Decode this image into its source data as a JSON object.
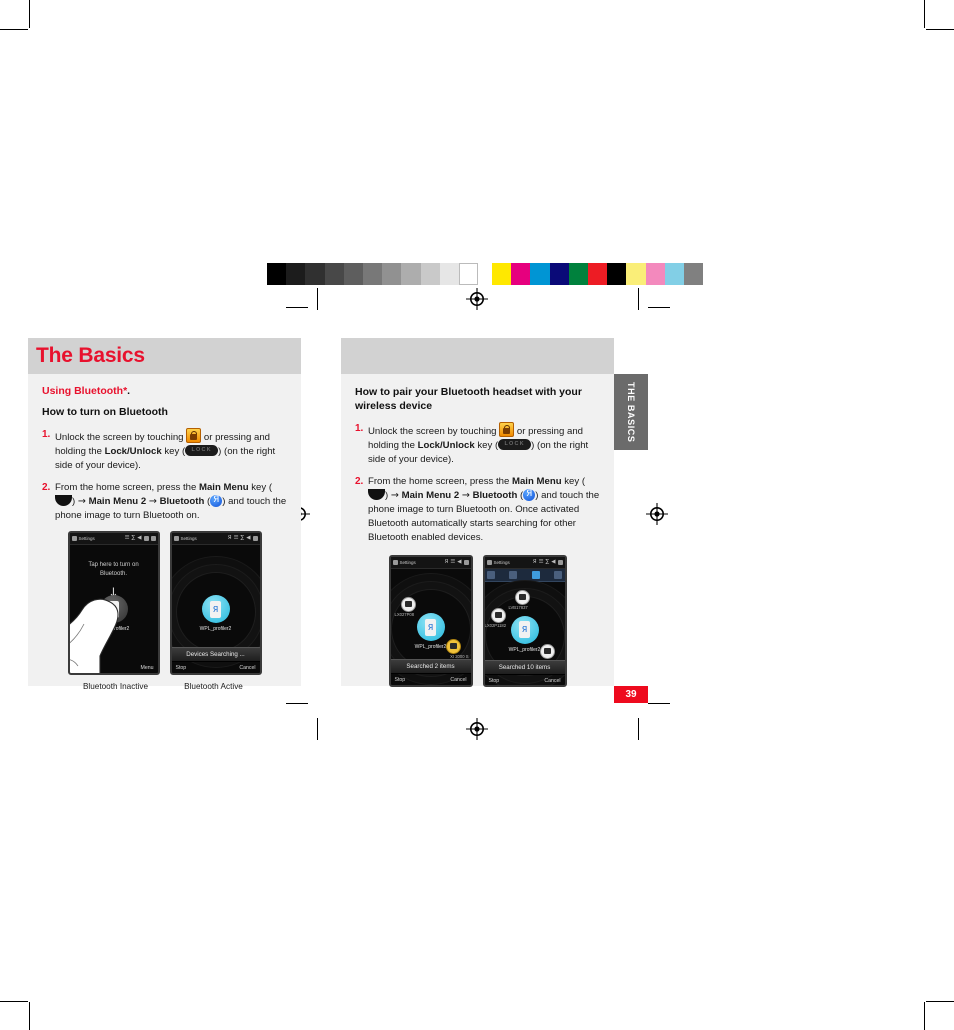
{
  "document": {
    "page_number": "39",
    "side_tab_label": "THE BASICS"
  },
  "left_column": {
    "header_title": "The Basics",
    "section_label_red": "Using Bluetooth*",
    "section_label_suffix": ".",
    "subheading": "How to turn on Bluetooth",
    "steps": [
      {
        "number": "1.",
        "part1": "Unlock the screen by touching",
        "part2": "or pressing and holding the",
        "bold1": "Lock/Unlock",
        "part3": "key (",
        "key_label": "LOCK",
        "part4": ") (on the right side of your device)."
      },
      {
        "number": "2.",
        "part1": "From the home screen, press the",
        "bold1": "Main Menu",
        "part2": "key (",
        "part3": ")",
        "arrow": "→",
        "bold2": "Main Menu 2",
        "bold3": "Bluetooth",
        "part4": "(",
        "part5": ") and touch the phone image to turn Bluetooth on."
      }
    ],
    "figures": [
      {
        "caption": "Bluetooth Inactive",
        "hint_line1": "Tap here to turn on",
        "hint_line2": "Bluetooth.",
        "arrow_glyph": "↓",
        "device_label": "WPL_profiler2",
        "menu_softkey": "Menu",
        "status_app": "Settings"
      },
      {
        "caption": "Bluetooth Active",
        "status_bar_text": "Devices Searching ...",
        "device_label": "WPL_profiler2",
        "softkey_left": "Stop",
        "softkey_right": "Cancel",
        "status_app": "Settings"
      }
    ]
  },
  "right_column": {
    "subheading": "How to pair your Bluetooth headset with your wireless device",
    "steps": [
      {
        "number": "1.",
        "part1": "Unlock the screen by touching",
        "part2": "or pressing and holding the",
        "bold1": "Lock/Unlock",
        "part3": "key (",
        "key_label": "LOCK",
        "part4": ") (on the right side of your device)."
      },
      {
        "number": "2.",
        "part1": "From the home screen, press the",
        "bold1": "Main Menu",
        "part2": "key (",
        "part3": ")",
        "arrow": "→",
        "bold2": "Main Menu 2",
        "bold3": "Bluetooth",
        "part4": "(",
        "part5": ") and touch the phone image to turn Bluetooth on. Once activated Bluetooth automatically starts searching for other Bluetooth enabled devices."
      }
    ],
    "figures": [
      {
        "status_bar_text": "Searched 2 items",
        "device_label": "WPL_profiler2",
        "node_labels": [
          "LX027P08",
          "XI 2000    S"
        ],
        "softkey_left": "Stop",
        "softkey_right": "Cancel",
        "status_app": "Settings"
      },
      {
        "status_bar_text": "Searched 10 items",
        "device_label": "WPL_profiler2",
        "node_labels": [
          "LVB17837",
          "LX02P1182",
          "LVB14059"
        ],
        "softkey_left": "Stop",
        "softkey_right": "Cancel",
        "status_app": "Settings"
      }
    ]
  },
  "calibration_strip": {
    "grayscale": [
      "#000000",
      "#1c1c1c",
      "#303030",
      "#484848",
      "#5e5e5e",
      "#787878",
      "#919191",
      "#adadad",
      "#c9c9c9",
      "#e6e6e6",
      "#ffffff"
    ],
    "colors": [
      "#ffe800",
      "#e6007e",
      "#0095d4",
      "#0a0a78",
      "#00813d",
      "#ed1c24",
      "#000000",
      "#faee78",
      "#f389bd",
      "#82cfe6",
      "#808080"
    ]
  },
  "theme": {
    "accent_red": "#e8112d",
    "badge_red": "#ee0a1e",
    "header_gray": "#d2d2d2",
    "body_gray": "#f1f1f1",
    "tab_gray": "#6b6b6b"
  }
}
